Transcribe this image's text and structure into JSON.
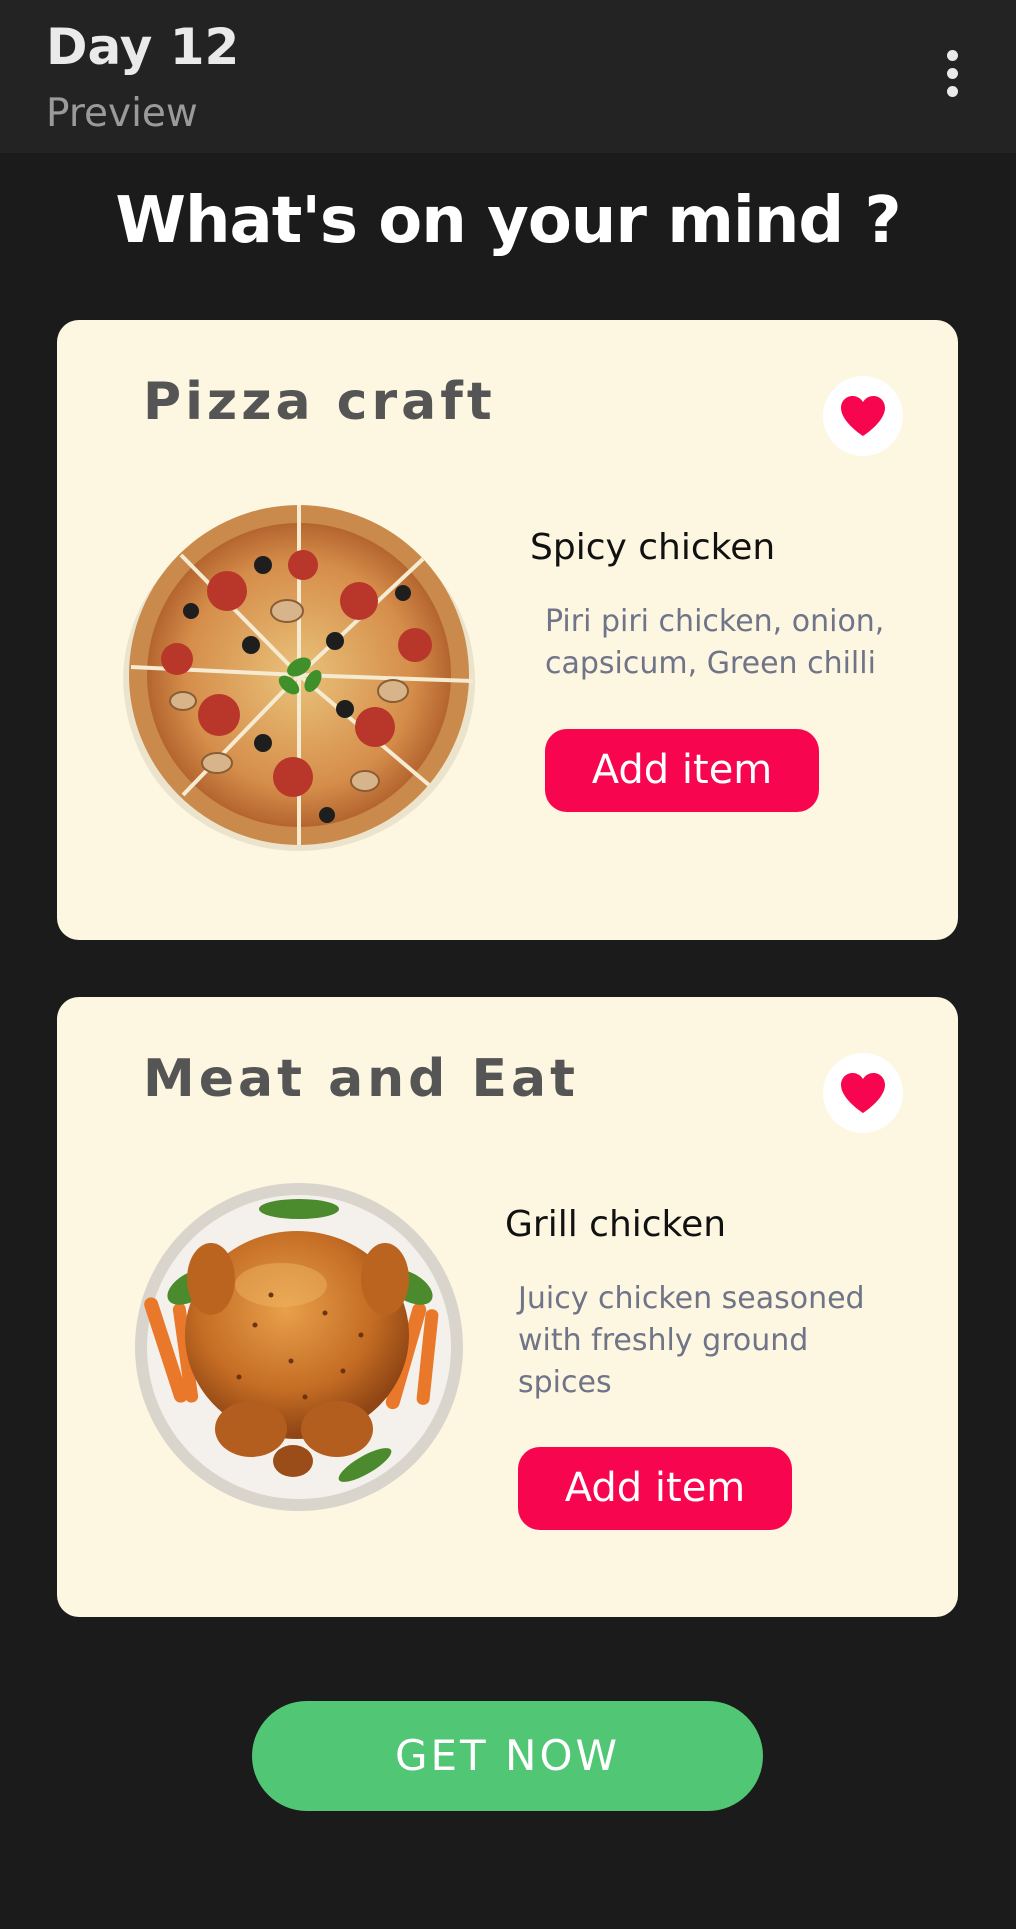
{
  "appbar": {
    "title": "Day 12",
    "subtitle": "Preview",
    "menu_icon": "more-vertical-icon"
  },
  "headline": "What's on your mind ?",
  "cards": [
    {
      "title": "Pizza craft",
      "favorite_icon": "heart-icon",
      "image": "pizza-image",
      "item_name": "Spicy chicken",
      "desc_lines": [
        "Piri piri chicken, onion,",
        "capsicum, Green chilli"
      ],
      "button_label": "Add item"
    },
    {
      "title": "Meat and Eat",
      "favorite_icon": "heart-icon",
      "image": "roast-chicken-image",
      "item_name": "Grill chicken",
      "desc_lines": [
        "Juicy chicken seasoned",
        "with freshly ground",
        "spices"
      ],
      "button_label": "Add item"
    }
  ],
  "cta": {
    "label": "GET NOW"
  },
  "colors": {
    "background": "#1b1b1b",
    "appbar": "#232323",
    "card": "#fdf6e1",
    "accent": "#f7064f",
    "cta": "#51c675"
  }
}
